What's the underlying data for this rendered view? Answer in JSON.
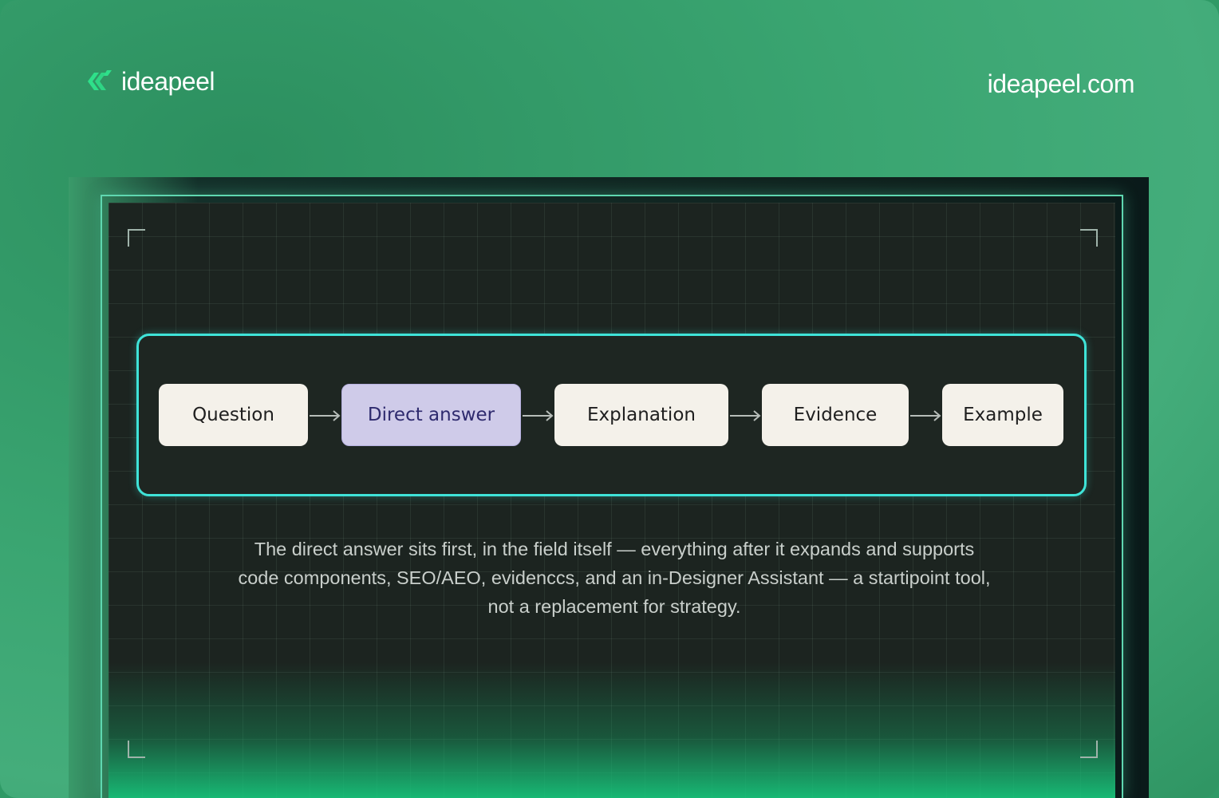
{
  "brand": {
    "name": "ideapeel",
    "accent": "#2ee08a"
  },
  "site_url": "ideapeel.com",
  "diagram": {
    "steps": [
      {
        "label": "Question",
        "highlighted": false
      },
      {
        "label": "Direct answer",
        "highlighted": true
      },
      {
        "label": "Explanation",
        "highlighted": false
      },
      {
        "label": "Evidence",
        "highlighted": false
      },
      {
        "label": "Example",
        "highlighted": false
      }
    ],
    "panel_border_color": "#3fe3d8",
    "highlight_color": "#cfcbe9"
  },
  "caption": {
    "line1": "The direct answer sits first, in the field itself — everything after it expands and supports",
    "line2": "code components, SEO/AEO, evidenccs, and an in-Designer Assistant — a startipoint tool,",
    "line3": "not a replacement for strategy."
  }
}
